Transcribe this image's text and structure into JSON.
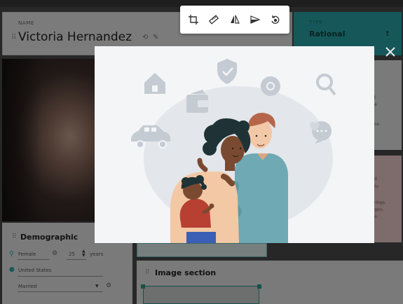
{
  "name_card": {
    "label": "NAME",
    "value": "Victoria Hernandez"
  },
  "type_card": {
    "label": "TYPE",
    "value": "Rational"
  },
  "demographic": {
    "title": "Demographic",
    "gender": "Female",
    "age": "25",
    "age_unit": "years",
    "location": "United States",
    "marital": "Married"
  },
  "image_section": {
    "title": "Image section"
  },
  "right_snippets": {
    "card1": [
      "t",
      "e",
      "",
      "ce"
    ],
    "card2": [
      "d",
      "to",
      "",
      "rings.",
      "gon,",
      "e."
    ]
  },
  "toolbar": {
    "tools": [
      "crop-icon",
      "ruler-icon",
      "flip-icon",
      "straighten-icon",
      "rotate-icon"
    ]
  },
  "colors": {
    "teal": "#2aa7a9",
    "pink": "#eecdcd",
    "overlay": "rgba(0,0,0,0.47)"
  }
}
